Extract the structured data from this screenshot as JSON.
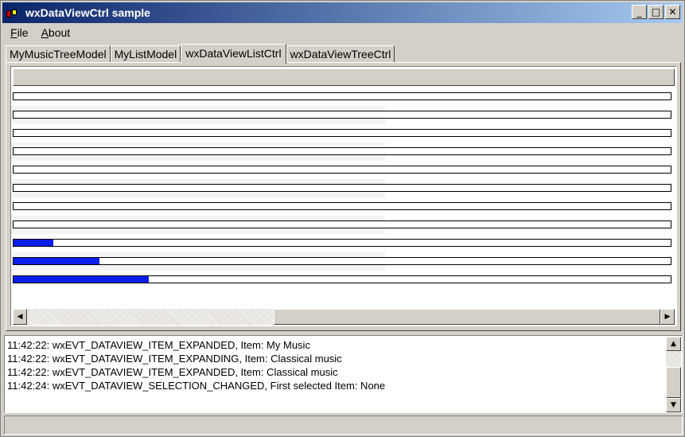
{
  "window": {
    "title": "wxDataViewCtrl sample"
  },
  "caption_buttons": {
    "minimize": "_",
    "maximize": "□",
    "close": "✕"
  },
  "menu": {
    "items": [
      {
        "accel": "F",
        "rest": "ile"
      },
      {
        "accel": "A",
        "rest": "bout"
      }
    ]
  },
  "tabs": [
    {
      "label": "MyMusicTreeModel",
      "active": false
    },
    {
      "label": "MyListModel",
      "active": false
    },
    {
      "label": "wxDataViewListCtrl",
      "active": true
    },
    {
      "label": "wxDataViewTreeCtrl",
      "active": false
    }
  ],
  "list": {
    "rows": [
      {
        "progress": 0
      },
      {
        "progress": 0
      },
      {
        "progress": 0
      },
      {
        "progress": 0
      },
      {
        "progress": 0
      },
      {
        "progress": 0
      },
      {
        "progress": 0
      },
      {
        "progress": 0
      },
      {
        "progress": 0.06
      },
      {
        "progress": 0.13
      },
      {
        "progress": 0.205
      }
    ],
    "scroll": {
      "left_arrow": "◀",
      "right_arrow": "▶"
    }
  },
  "log": {
    "lines": [
      "11:42:22: wxEVT_DATAVIEW_ITEM_EXPANDED, Item: My Music",
      "11:42:22: wxEVT_DATAVIEW_ITEM_EXPANDING, Item: Classical music",
      "11:42:22: wxEVT_DATAVIEW_ITEM_EXPANDED, Item: Classical music",
      "11:42:24: wxEVT_DATAVIEW_SELECTION_CHANGED, First selected Item: None"
    ],
    "scroll": {
      "up_arrow": "▲",
      "down_arrow": "▼"
    }
  },
  "colors": {
    "titlebar_start": "#0a246a",
    "titlebar_end": "#a6caf0",
    "progress_fill": "#0a1ef0",
    "face": "#d4d0c8"
  }
}
